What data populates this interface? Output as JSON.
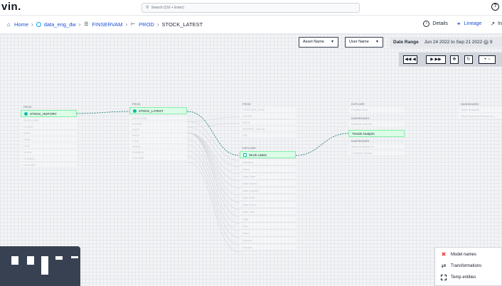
{
  "app": {
    "logo": "vin."
  },
  "search": {
    "placeholder": "Search (Ctrl + Enter)"
  },
  "breadcrumbs": [
    {
      "label": "Home",
      "icon": "home-icon"
    },
    {
      "label": "data_eng_dw",
      "icon": "database-icon"
    },
    {
      "label": "FINSERVAM",
      "icon": "schema-icon"
    },
    {
      "label": "PROD",
      "icon": "hierarchy-icon"
    },
    {
      "label": "STOCK_LATEST",
      "icon": ""
    }
  ],
  "tabs": [
    {
      "label": "Details",
      "icon": "info-icon"
    },
    {
      "label": "Lineage",
      "icon": "lineage-icon",
      "active": true
    },
    {
      "label": "In",
      "icon": "trend-icon"
    }
  ],
  "filters": {
    "asset_name": "Asset Name",
    "user_name": "User Name",
    "date_range_label": "Date Range",
    "date_range_value": "Jun 24 2022 to Sep 21 2022",
    "date_range_tail": "9"
  },
  "controls": [
    "skip-back",
    "step-back",
    "step-forward",
    "skip-forward",
    "center",
    "refresh",
    "zoom-in",
    "zoom-out"
  ],
  "lineage": {
    "col1": {
      "group": "PROD",
      "node": "STOCK_HISTORY",
      "fields": [
        "ADJCLOSE",
        "CLOSE",
        "DATE",
        "HIGH",
        "LOW",
        "OPEN",
        "SYMBOL",
        "VOLUME"
      ]
    },
    "col2": {
      "group": "PROD",
      "node": "STOCK_LATEST",
      "fields": [
        "ADJCLOSE",
        "CLOSE",
        "DATE",
        "HIGH",
        "LOW",
        "OPEN",
        "SYMBOL",
        "VOLUME"
      ]
    },
    "col3": {
      "group": "PROD",
      "top": [
        "POSITION_NOW",
        "CLOSE",
        "DATE",
        "MARKET_VALUE",
        "PNL"
      ],
      "explore_label": "EXPLORE",
      "node": "Stock Latest",
      "fields": [
        "Adjclose",
        "Close",
        "Date Date",
        "Date Month",
        "Date Quarter",
        "Date Raw",
        "Date Week",
        "Date Year",
        "High",
        "Low",
        "Open",
        "Symbol",
        "Volume"
      ]
    },
    "col4": {
      "explore_label": "EXPLORE",
      "explore_item": "Position Now",
      "dash1_label": "DASHBOARD",
      "dash1_item": "Realtime Stocks",
      "node": "Trends Analysis",
      "dash2_label": "DASHBOARD",
      "dash2_items": [
        "Stock Analysis V2",
        "Compare Stocks"
      ]
    },
    "col5": {
      "dash_label": "DASHBOARD",
      "items": [
        "Stock Analysis",
        "Stock Symbols Shares on..."
      ]
    }
  },
  "legend": {
    "items": [
      {
        "label": "Model names",
        "icon": "model-icon"
      },
      {
        "label": "Transformations",
        "icon": "transform-icon"
      },
      {
        "label": "Temp entities",
        "icon": "temp-icon"
      }
    ]
  },
  "colors": {
    "accent": "#1d4ed8",
    "node_fill": "#dcfce7",
    "node_border": "#86efac",
    "edge": "#0f766e",
    "model": "#ef4444"
  }
}
